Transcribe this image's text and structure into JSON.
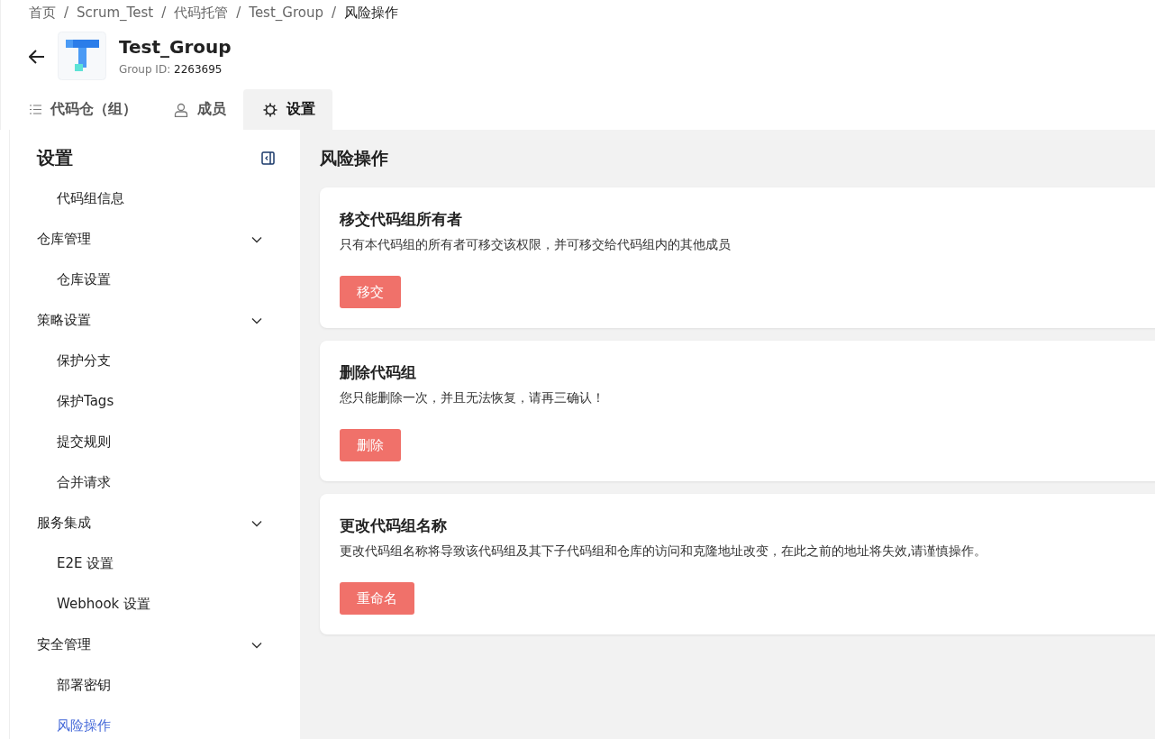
{
  "breadcrumb": [
    {
      "label": "首页"
    },
    {
      "label": "Scrum_Test"
    },
    {
      "label": "代码托管"
    },
    {
      "label": "Test_Group"
    },
    {
      "label": "风险操作"
    }
  ],
  "breadcrumb_separator": "/",
  "header": {
    "title": "Test_Group",
    "id_label": "Group ID:",
    "id_value": "2263695"
  },
  "tabs": [
    {
      "label": "代码仓（组）",
      "kind": "list",
      "selected": false
    },
    {
      "label": "成员",
      "kind": "person",
      "selected": false
    },
    {
      "label": "设置",
      "kind": "gear",
      "selected": true
    }
  ],
  "sidebar": {
    "title": "设置",
    "items": [
      {
        "kind": "link",
        "label": "代码组信息",
        "selected": false
      },
      {
        "kind": "group",
        "label": "仓库管理",
        "expanded": true,
        "children": [
          {
            "label": "仓库设置",
            "selected": false
          }
        ]
      },
      {
        "kind": "group",
        "label": "策略设置",
        "expanded": true,
        "children": [
          {
            "label": "保护分支",
            "selected": false
          },
          {
            "label": "保护Tags",
            "selected": false
          },
          {
            "label": "提交规则",
            "selected": false
          },
          {
            "label": "合并请求",
            "selected": false
          }
        ]
      },
      {
        "kind": "group",
        "label": "服务集成",
        "expanded": true,
        "children": [
          {
            "label": "E2E 设置",
            "selected": false
          },
          {
            "label": "Webhook 设置",
            "selected": false
          }
        ]
      },
      {
        "kind": "group",
        "label": "安全管理",
        "expanded": true,
        "children": [
          {
            "label": "部署密钥",
            "selected": false
          },
          {
            "label": "风险操作",
            "selected": true
          }
        ]
      }
    ]
  },
  "page_title": "风险操作",
  "cards": [
    {
      "title": "移交代码组所有者",
      "description": "只有本代码组的所有者可移交该权限，并可移交给代码组内的其他成员",
      "button": "移交"
    },
    {
      "title": "删除代码组",
      "description": "您只能删除一次，并且无法恢复，请再三确认！",
      "button": "删除"
    },
    {
      "title": "更改代码组名称",
      "description": "更改代码组名称将导致该代码组及其下子代码组和仓库的访问和克隆地址改变，在此之前的地址将失效,请谨慎操作。",
      "button": "重命名"
    }
  ]
}
